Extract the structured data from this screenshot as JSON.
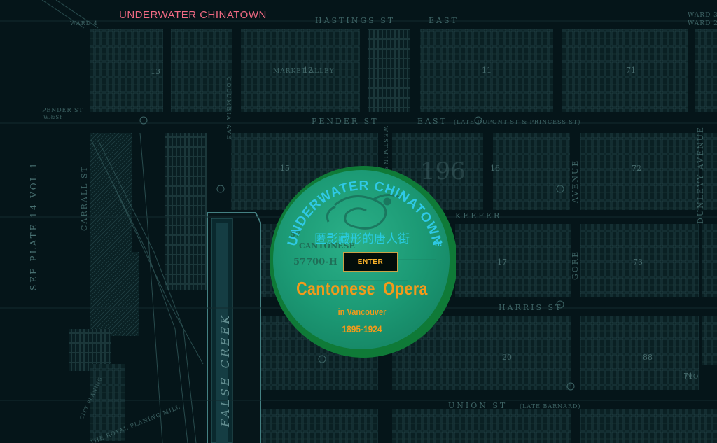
{
  "header": {
    "site_title": "UNDERWATER CHINATOWN"
  },
  "record": {
    "arc_title": "UNDERWATER  CHINATOWN",
    "arc_mark": "n!",
    "chinese_title": "匿影藏形的唐人街",
    "label_brand": "CANTONESE",
    "label_number": "57700-H",
    "label_small": "57",
    "enter_label": "ENTER",
    "main_title": "Cantonese Opera",
    "subtitle": "in Vancouver",
    "years": "1895-1924",
    "colors": {
      "disc_fill": "#1fa07c",
      "disc_edge": "#0e8a3c",
      "arc_text": "#2fc9e6",
      "accent": "#f39a1a"
    }
  },
  "map": {
    "streets": {
      "hastings": "HASTINGS   ST",
      "hastings_east": "EAST",
      "pender": "PENDER   ST",
      "pender_east": "EAST",
      "pender_note": "(LATE DUPONT ST & PRINCESS ST)",
      "pender_west": "PENDER ST",
      "pender_west_sub": "W.&Sf",
      "harris": "HARRIS   ST",
      "union": "UNION   ST",
      "union_note": "(LATE BARNARD)",
      "keefer": "KEEFER",
      "carrall": "CARRALL   ST",
      "columbia": "COLUMBIA AVE",
      "westminster": "WESTMINSTER AVE",
      "gore": "GORE",
      "avenue": "AVENUE",
      "dunlevy": "DUNLEVY AVENUE",
      "market_alley": "MARKET ALLEY",
      "false_creek": "FALSE CREEK",
      "see_plate": "SEE PLATE 14 VOL 1",
      "ward3": "WARD 3",
      "ward2": "WARD 2",
      "ward4": "WARD 4",
      "planing_mill": "THE ROYAL PLANING MILL",
      "city_planing": "CITY PLANING",
      "vo": "(VO"
    },
    "block_numbers": [
      "13",
      "12",
      "11",
      "71",
      "15",
      "196",
      "16",
      "72",
      "17",
      "73",
      "20",
      "88",
      "71"
    ]
  }
}
